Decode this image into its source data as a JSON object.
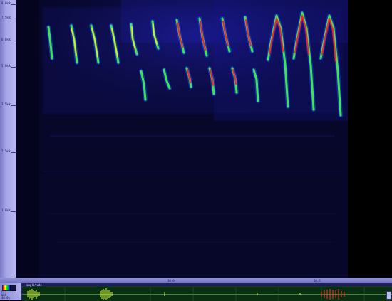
{
  "frequency_axis": {
    "labels": [
      "8.0kHz",
      "7.5kHz",
      "6.0kHz",
      "5.0kHz",
      "3.5kHz",
      "2.5kHz",
      "1.0kHz"
    ]
  },
  "time_axis": {
    "labels": [
      "10.0",
      "10.5"
    ]
  },
  "overview": {
    "title": "amplitude",
    "side_lines": [
      "FFT",
      "WAV",
      "48.0k"
    ],
    "palette_colors": [
      "#ff0000",
      "#ffff00",
      "#00ff00",
      "#0000ff"
    ]
  },
  "icons": {
    "palette": "color-palette-icon",
    "mode": "display-mode-icon",
    "scroll": "scroll-handle-icon"
  }
}
